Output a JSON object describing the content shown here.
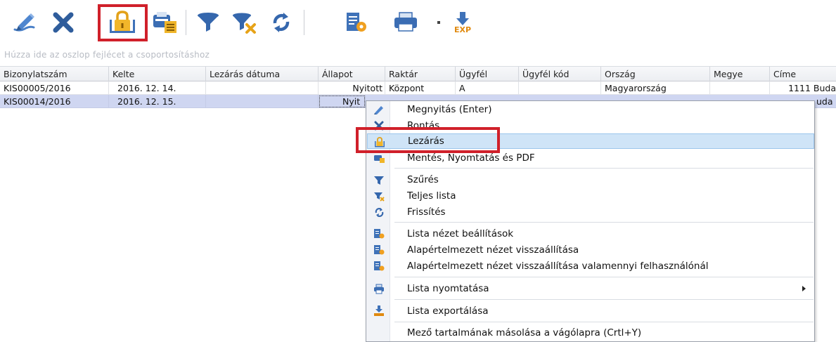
{
  "toolbar": {
    "icons": [
      "pencil-icon",
      "close-x-icon",
      "lock-icon",
      "save-print-pdf-icon",
      "filter-icon",
      "filter-clear-icon",
      "refresh-icon",
      "list-settings-icon",
      "print-icon",
      "export-icon"
    ],
    "export_label": "EXP",
    "highlight_color": "#d0202a"
  },
  "group_panel": {
    "hint": "Húzza ide az oszlop fejlécet a csoportosításhoz"
  },
  "grid": {
    "columns": [
      "Bizonylatszám",
      "Kelte",
      "Lezárás dátuma",
      "Állapot",
      "Raktár",
      "Ügyfél",
      "Ügyfél kód",
      "Ország",
      "Megye",
      "Címe"
    ],
    "rows": [
      [
        "KIS00005/2016",
        "2016. 12. 14.",
        "",
        "Nyitott",
        "Központ",
        "A",
        "",
        "Magyarország",
        "",
        "1111 Buda"
      ],
      [
        "KIS00014/2016",
        "2016. 12. 15.",
        "",
        "Nyit",
        "",
        "",
        "",
        "",
        "",
        "uda"
      ]
    ],
    "selected_row_color": "#cfd6f1"
  },
  "context_menu": {
    "items": [
      {
        "label": "Megnyitás (Enter)",
        "icon": "pencil-icon"
      },
      {
        "label": "Rontás",
        "icon": "close-x-icon"
      },
      {
        "label": "Lezárás",
        "icon": "lock-icon"
      },
      {
        "label": "Mentés, Nyomtatás és PDF",
        "icon": "save-print-pdf-icon"
      },
      {
        "label": "Szűrés",
        "icon": "filter-icon"
      },
      {
        "label": "Teljes lista",
        "icon": "filter-clear-icon"
      },
      {
        "label": "Frissítés",
        "icon": "refresh-icon"
      },
      {
        "label": "Lista nézet beállítások",
        "icon": "list-settings-icon"
      },
      {
        "label": "Alapértelmezett nézet visszaállítása",
        "icon": "list-settings-icon"
      },
      {
        "label": "Alapértelmezett nézet visszaállítása valamennyi felhasználónál",
        "icon": "list-settings-icon"
      },
      {
        "label": "Lista nyomtatása",
        "icon": "print-icon"
      },
      {
        "label": "Lista exportálása",
        "icon": "export-icon"
      },
      {
        "label": "Mező tartalmának másolása a vágólapra (Crtl+Y)",
        "icon": ""
      }
    ],
    "hover_color": "#cfe4f7"
  }
}
